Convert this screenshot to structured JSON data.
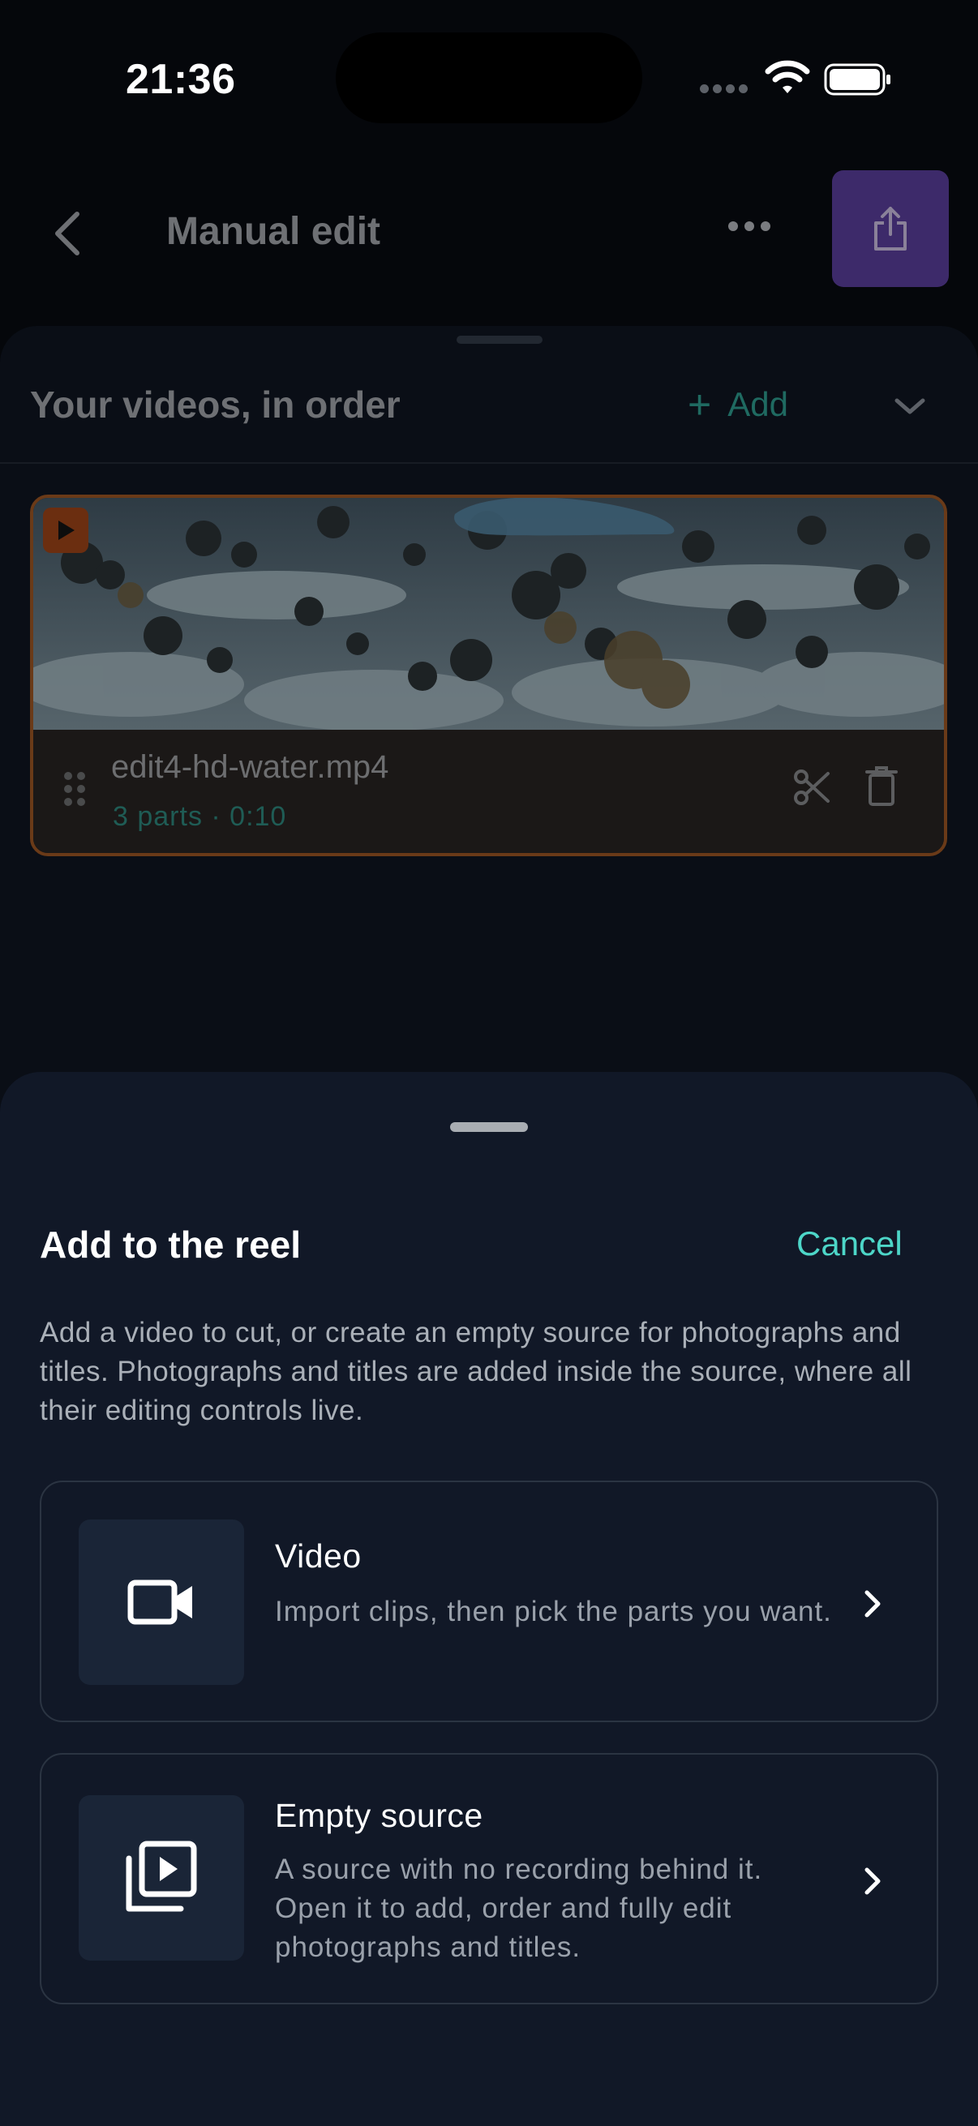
{
  "status": {
    "time": "21:36"
  },
  "header": {
    "title": "Manual edit"
  },
  "reel": {
    "title": "Your videos, in order",
    "add_label": "Add",
    "items": [
      {
        "file_name": "edit4-hd-water.mp4",
        "meta": "3 parts · 0:10"
      }
    ]
  },
  "sheet": {
    "title": "Add to the reel",
    "cancel_label": "Cancel",
    "description": "Add a video to cut, or create an empty source for photographs and titles. Photographs and titles are added inside the source, where all their editing controls live.",
    "options": [
      {
        "title": "Video",
        "subtitle": "Import clips, then pick the parts you want.",
        "icon": "video-camera-icon"
      },
      {
        "title": "Empty source",
        "subtitle": "A source with no recording behind it. Open it to add, order and fully edit photographs and titles.",
        "icon": "media-stack-icon"
      }
    ]
  },
  "colors": {
    "accent_teal": "#4dd6c8",
    "share_purple": "#3d2a6a",
    "card_border": "#6a3a18",
    "sheet_bg": "#111827"
  }
}
